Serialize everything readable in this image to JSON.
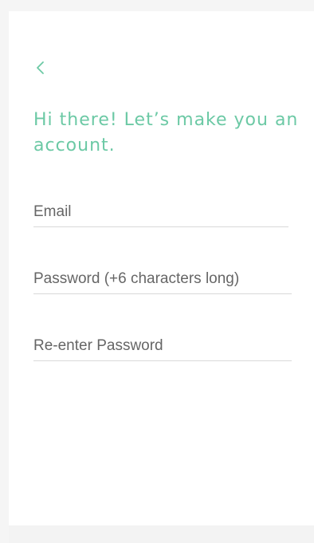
{
  "signup": {
    "back_icon": "chevron-left-icon",
    "title": "Hi there! Let’s make you an account.",
    "fields": [
      {
        "name": "email",
        "placeholder": "Email",
        "value": ""
      },
      {
        "name": "password",
        "placeholder": "Password (+6 characters long)",
        "value": ""
      },
      {
        "name": "confirm_password",
        "placeholder": "Re-enter Password",
        "value": ""
      }
    ]
  },
  "colors": {
    "accent": "#6cc9a5",
    "background": "#f5f5f5",
    "card": "#ffffff",
    "divider": "#d9d9d9",
    "placeholder": "#666666"
  }
}
